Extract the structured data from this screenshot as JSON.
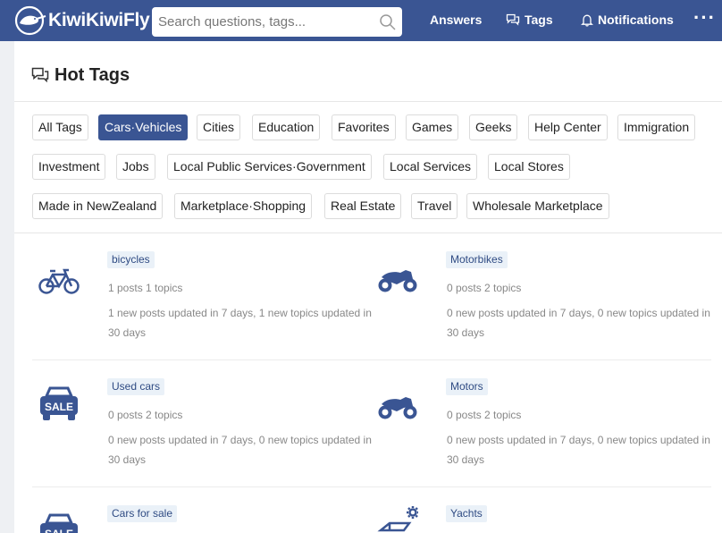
{
  "brand": {
    "name": "KiwiKiwiFly"
  },
  "search": {
    "placeholder": "Search questions, tags..."
  },
  "nav": {
    "answers": "Answers",
    "tags": "Tags",
    "notifications": "Notifications",
    "more": "···"
  },
  "page": {
    "title": "Hot Tags"
  },
  "filters": [
    "All Tags",
    "Cars·Vehicles",
    "Cities",
    "Education",
    "Favorites",
    "Games",
    "Geeks",
    "Help Center",
    "Immigration",
    "Investment",
    "Jobs",
    "Local Public Services·Government",
    "Local Services",
    "Local Stores",
    "Made in NewZealand",
    "Marketplace·Shopping",
    "Real Estate",
    "Travel",
    "Wholesale Marketplace"
  ],
  "active_filter": "Cars·Vehicles",
  "cards": [
    {
      "tag": "bicycles",
      "stats": "1 posts 1 topics",
      "updated": "1 new posts updated in 7 days, 1 new topics updated in 30 days",
      "icon": "bicycle-icon"
    },
    {
      "tag": "Motorbikes",
      "stats": "0 posts 2 topics",
      "updated": "0 new posts updated in 7 days, 0 new topics updated in 30 days",
      "icon": "motorbike-icon"
    },
    {
      "tag": "Used cars",
      "stats": "0 posts 2 topics",
      "updated": "0 new posts updated in 7 days, 0 new topics updated in 30 days",
      "icon": "car-sale-icon"
    },
    {
      "tag": "Motors",
      "stats": "0 posts 2 topics",
      "updated": "0 new posts updated in 7 days, 0 new topics updated in 30 days",
      "icon": "motorbike-icon"
    },
    {
      "tag": "Cars for sale",
      "stats": "",
      "updated": "",
      "icon": "car-sale-icon"
    },
    {
      "tag": "Yachts",
      "stats": "",
      "updated": "",
      "icon": "yacht-icon"
    }
  ],
  "icon_labels": {
    "sale": "SALE"
  },
  "colors": {
    "brand": "#3a5593",
    "tag_bg": "#eaf1f8",
    "tag_text": "#2f4b83",
    "icon": "#3a5593"
  }
}
